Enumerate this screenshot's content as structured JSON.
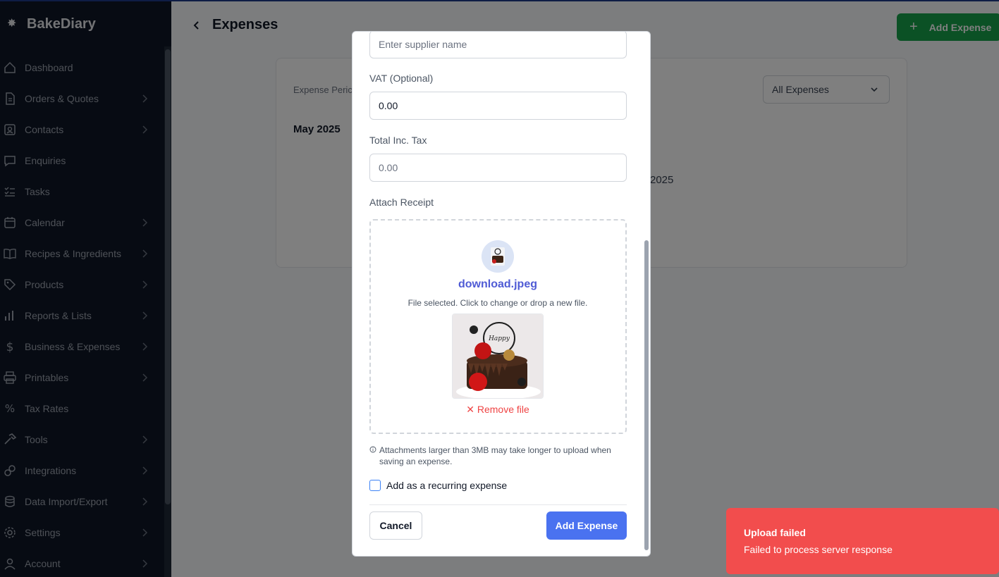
{
  "app": {
    "name": "BakeDiary"
  },
  "sidebar": {
    "items": [
      {
        "label": "Dashboard",
        "icon": "home-icon",
        "chevron": false
      },
      {
        "label": "Orders & Quotes",
        "icon": "document-icon",
        "chevron": true
      },
      {
        "label": "Contacts",
        "icon": "contact-icon",
        "chevron": true
      },
      {
        "label": "Enquiries",
        "icon": "chat-icon",
        "chevron": false
      },
      {
        "label": "Tasks",
        "icon": "tasks-icon",
        "chevron": false
      },
      {
        "label": "Calendar",
        "icon": "calendar-icon",
        "chevron": true
      },
      {
        "label": "Recipes & Ingredients",
        "icon": "book-icon",
        "chevron": true
      },
      {
        "label": "Products",
        "icon": "tag-icon",
        "chevron": true
      },
      {
        "label": "Reports & Lists",
        "icon": "chart-icon",
        "chevron": true
      },
      {
        "label": "Business & Expenses",
        "icon": "dollar-icon",
        "chevron": true
      },
      {
        "label": "Printables",
        "icon": "printer-icon",
        "chevron": true
      },
      {
        "label": "Tax Rates",
        "icon": "percent-icon",
        "chevron": false
      },
      {
        "label": "Tools",
        "icon": "hammer-icon",
        "chevron": true
      },
      {
        "label": "Integrations",
        "icon": "link-icon",
        "chevron": true
      },
      {
        "label": "Data Import/Export",
        "icon": "database-icon",
        "chevron": true
      },
      {
        "label": "Settings",
        "icon": "gear-icon",
        "chevron": true
      },
      {
        "label": "Account",
        "icon": "user-icon",
        "chevron": true
      }
    ]
  },
  "page": {
    "title": "Expenses",
    "add_button": "Add Expense",
    "period_label": "Expense Peric",
    "month": "May 2025",
    "filter": "All Expenses",
    "year_fragment": "2025"
  },
  "modal": {
    "supplier_placeholder": "Enter supplier name",
    "vat_label": "VAT (Optional)",
    "vat_value": "0.00",
    "total_label": "Total Inc. Tax",
    "total_placeholder": "0.00",
    "receipt_label": "Attach Receipt",
    "file_name": "download.jpeg",
    "file_info": "File selected. Click to change or drop a new file.",
    "remove_file": "Remove file",
    "hint": "Attachments larger than 3MB may take longer to upload when saving an expense.",
    "recurring_label": "Add as a recurring expense",
    "cancel": "Cancel",
    "submit": "Add Expense"
  },
  "toast": {
    "title": "Upload failed",
    "message": "Failed to process server response"
  },
  "colors": {
    "primary": "#4a72f0",
    "success": "#16a34a",
    "danger": "#f24d4d",
    "sidebar_bg": "#0e1726"
  }
}
